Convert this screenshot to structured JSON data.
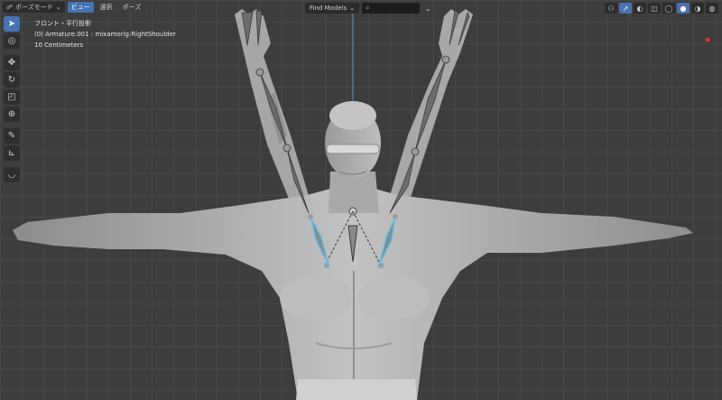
{
  "header": {
    "mode_label": "ポーズモード",
    "menus": [
      {
        "label": "ビュー",
        "active": true
      },
      {
        "label": "選択",
        "active": false
      },
      {
        "label": "ポーズ",
        "active": false
      }
    ],
    "find_label": "Find Models"
  },
  "viewport_info": {
    "line1": "フロント・平行投影",
    "line2": "(0) Armature.001 : mixamorig:RightShoulder",
    "line3": "10 Centimeters"
  },
  "toolbar": {
    "tools": [
      "select-box-icon",
      "cursor-icon",
      "move-icon",
      "rotate-icon",
      "scale-icon",
      "transform-icon",
      "annotate-icon",
      "measure-icon",
      "relax-icon"
    ]
  },
  "colors": {
    "accent": "#4772b3",
    "grid": "#474747",
    "background": "#3d3d3d",
    "selected_bone": "#6cc0e5"
  }
}
